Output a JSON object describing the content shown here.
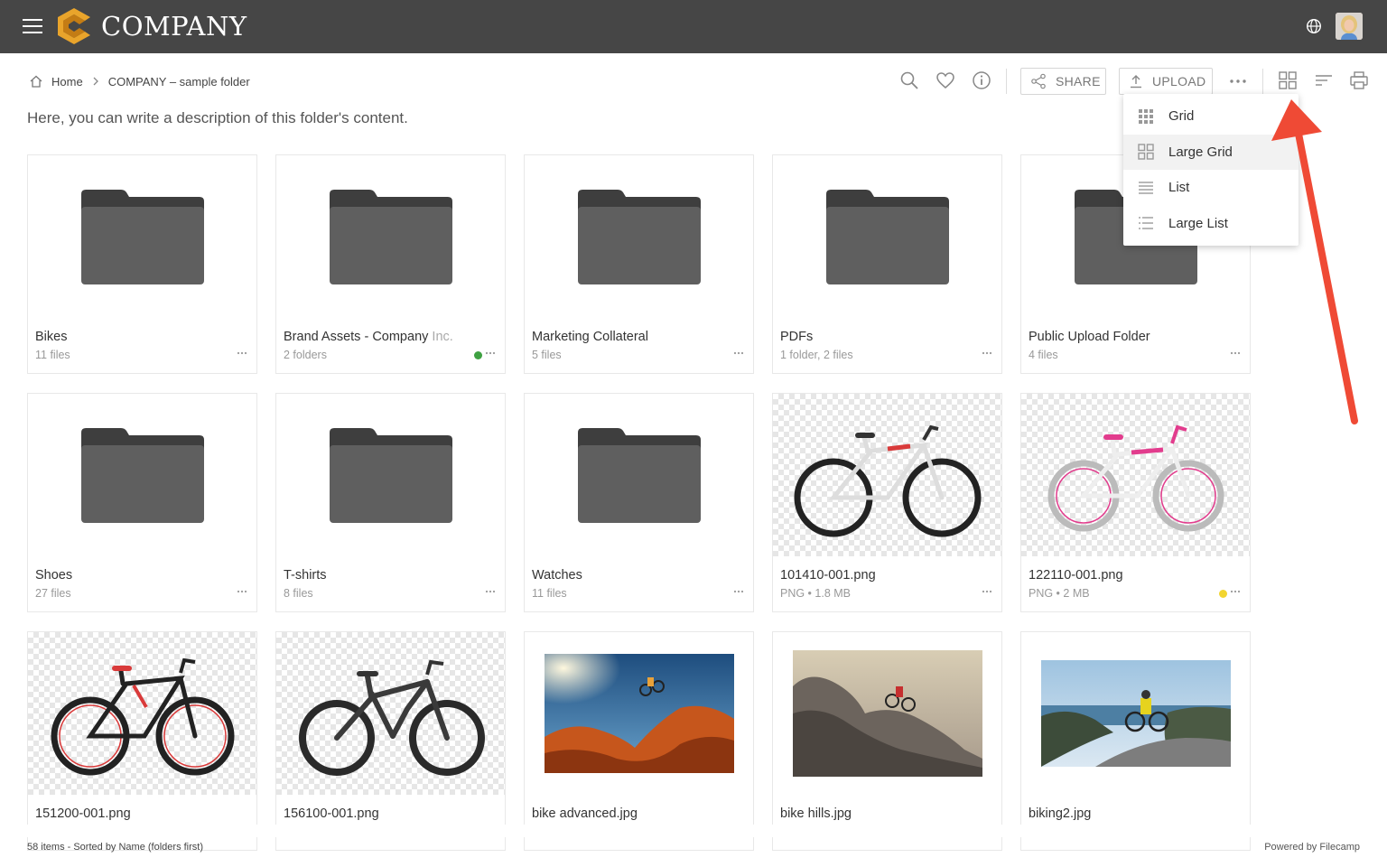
{
  "app": {
    "brand": "COMPANY",
    "brand_color": "#e9a42b",
    "topbar_color": "#464646"
  },
  "breadcrumb": {
    "home": "Home",
    "current": "COMPANY – sample folder"
  },
  "description": "Here, you can write a description of this folder's content.",
  "toolbar": {
    "share_label": "SHARE",
    "upload_label": "UPLOAD",
    "icons": [
      "search-icon",
      "heart-icon",
      "info-icon",
      "share-icon",
      "upload-icon",
      "more-icon",
      "grid-view-icon",
      "sort-icon",
      "print-icon"
    ]
  },
  "view_menu": {
    "items": [
      {
        "label": "Grid",
        "icon": "grid-small-icon"
      },
      {
        "label": "Large Grid",
        "icon": "grid-large-icon",
        "active": true
      },
      {
        "label": "List",
        "icon": "list-icon"
      },
      {
        "label": "Large List",
        "icon": "list-large-icon"
      }
    ]
  },
  "items": [
    {
      "name": "Bikes",
      "meta": "11 files",
      "type": "folder"
    },
    {
      "name": "Brand Assets - Company",
      "name_faded": " Inc.",
      "meta": "2 folders",
      "type": "folder",
      "status": "#3fa142"
    },
    {
      "name": "Marketing Collateral",
      "meta": "5 files",
      "type": "folder"
    },
    {
      "name": "PDFs",
      "meta": "1 folder, 2 files",
      "type": "folder"
    },
    {
      "name": "Public Upload Folder",
      "meta": "4 files",
      "type": "folder"
    },
    {
      "name": "Shoes",
      "meta": "27 files",
      "type": "folder"
    },
    {
      "name": "T-shirts",
      "meta": "8 files",
      "type": "folder"
    },
    {
      "name": "Watches",
      "meta": "11 files",
      "type": "folder"
    },
    {
      "name": "101410-001.png",
      "meta": "PNG • 1.8 MB",
      "type": "bike-image",
      "accent": "#d93a3a"
    },
    {
      "name": "122110-001.png",
      "meta": "PNG • 2 MB",
      "type": "bike-image",
      "accent": "#e23c8d",
      "status": "#f2d530"
    },
    {
      "name": "151200-001.png",
      "meta": "",
      "type": "bike-image",
      "accent": "#d93a3a"
    },
    {
      "name": "156100-001.png",
      "meta": "",
      "type": "bike-image",
      "accent": "#555555"
    },
    {
      "name": "bike advanced.jpg",
      "meta": "",
      "type": "photo"
    },
    {
      "name": "bike hills.jpg",
      "meta": "",
      "type": "photo"
    },
    {
      "name": "biking2.jpg",
      "meta": "",
      "type": "photo"
    }
  ],
  "footer": {
    "summary": "58 items - Sorted by Name (folders first)",
    "powered": "Powered by Filecamp"
  }
}
